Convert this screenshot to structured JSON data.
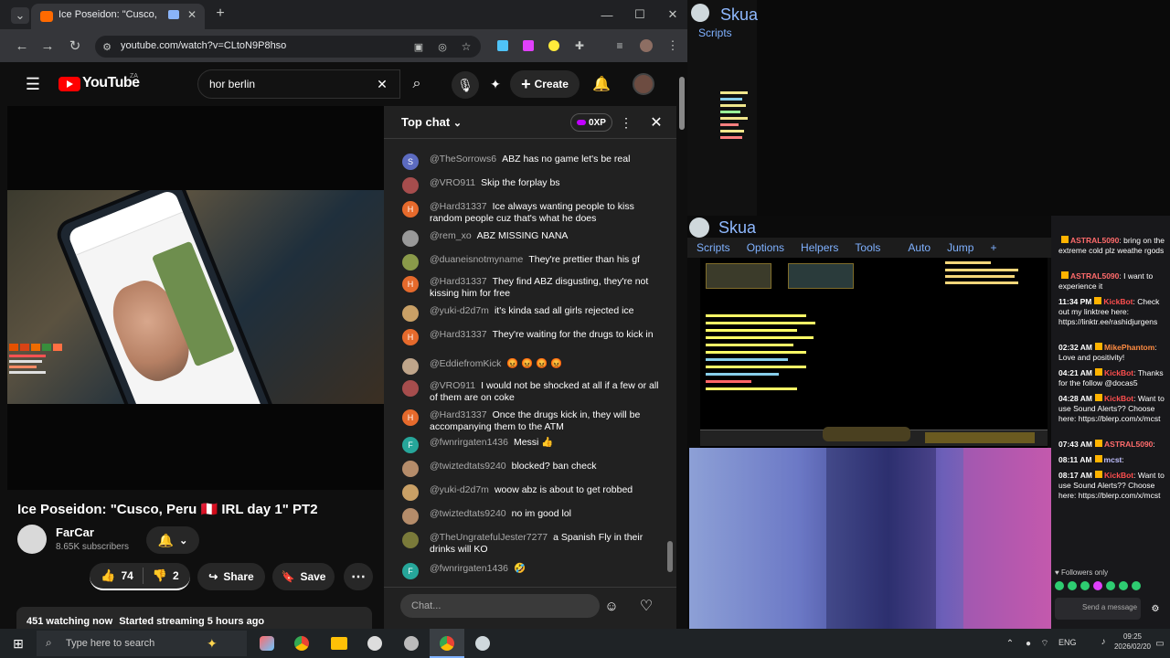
{
  "browser": {
    "tab_title": "Ice Poseidon: \"Cusco, Peru",
    "url": "youtube.com/watch?v=CLtoN9P8hso"
  },
  "youtube": {
    "logo": "YouTube",
    "region": "ZA",
    "search_value": "hor berlin",
    "create_label": "Create",
    "video_title": "Ice Poseidon: \"Cusco, Peru 🇵🇪 IRL day 1\" PT2",
    "channel_name": "FarCar",
    "subscribers": "8.65K subscribers",
    "likes": "74",
    "dislikes": "2",
    "share_label": "Share",
    "save_label": "Save",
    "watching": "451 watching now",
    "started": "Started streaming 5 hours ago"
  },
  "chat": {
    "header": "Top chat",
    "xp_label": "0XP",
    "placeholder": "Chat...",
    "messages": [
      {
        "author": "@TheSorrows6",
        "text": "ABZ has no game let's be real",
        "color": "#5c6bc0",
        "initial": "S"
      },
      {
        "author": "@VRO911",
        "text": "Skip the forplay bs",
        "color": "#a64d4d",
        "initial": ""
      },
      {
        "author": "@Hard31337",
        "text": "Ice always wanting people to kiss random people cuz that's what he does",
        "color": "#e66a2c",
        "initial": "H"
      },
      {
        "author": "@rem_xo",
        "text": "ABZ MISSING NANA",
        "color": "#999",
        "initial": ""
      },
      {
        "author": "@duaneisnotmyname",
        "text": "They're prettier than his gf",
        "color": "#8a9a4a",
        "initial": ""
      },
      {
        "author": "@Hard31337",
        "text": "They find ABZ disgusting, they're not kissing him for free",
        "color": "#e66a2c",
        "initial": "H"
      },
      {
        "author": "@yuki-d2d7m",
        "text": "it's kinda sad all girls rejected ice",
        "color": "#c9a066",
        "initial": ""
      },
      {
        "author": "@Hard31337",
        "text": "They're waiting for the drugs to kick in",
        "color": "#e66a2c",
        "initial": "H"
      },
      {
        "author": "@EddiefromKick",
        "text": "😡 😡 😡 😡",
        "color": "#bfa58a",
        "initial": ""
      },
      {
        "author": "@VRO911",
        "text": "I would not be shocked at all if a few or all of them are on coke",
        "color": "#a64d4d",
        "initial": ""
      },
      {
        "author": "@Hard31337",
        "text": "Once the drugs kick in, they will be accompanying them to the ATM",
        "color": "#e66a2c",
        "initial": "H"
      },
      {
        "author": "@fwnrirgaten1436",
        "text": "Messi 👍",
        "color": "#26a69a",
        "initial": "F"
      },
      {
        "author": "@twiztedtats9240",
        "text": "blocked? ban check",
        "color": "#b58c6a",
        "initial": ""
      },
      {
        "author": "@yuki-d2d7m",
        "text": "woow abz is about to get robbed",
        "color": "#c9a066",
        "initial": ""
      },
      {
        "author": "@twiztedtats9240",
        "text": "no im good lol",
        "color": "#b58c6a",
        "initial": ""
      },
      {
        "author": "@TheUngratefulJester7277",
        "text": "a Spanish Fly in their drinks will KO",
        "color": "#7a7a3a",
        "initial": ""
      },
      {
        "author": "@fwnrirgaten1436",
        "text": "🤣",
        "color": "#26a69a",
        "initial": "F"
      }
    ]
  },
  "skua": {
    "title": "Skua",
    "scripts": "Scripts",
    "menu": [
      "Scripts",
      "Options",
      "Helpers",
      "Tools",
      "Auto",
      "Jump",
      "+"
    ]
  },
  "twitch": {
    "messages": [
      {
        "time": "",
        "user": "ASTRAL5090",
        "text": ": bring on the extreme cold plz weathe rgods",
        "color": "#ff6b6b"
      },
      {
        "time": "",
        "user": "ASTRAL5090",
        "text": ": I want to experience it",
        "color": "#ff6b6b"
      },
      {
        "time": "11:34 PM",
        "user": "KickBot",
        "text": ": Check out my linktree here: https://linktr.ee/rashidjurgens",
        "color": "#ff4f4f"
      },
      {
        "time": "02:32 AM",
        "user": "MikePhantom",
        "text": ": Love and positivity!",
        "color": "#ff8c42"
      },
      {
        "time": "04:21 AM",
        "user": "KickBot",
        "text": ": Thanks for the follow @docas5",
        "color": "#ff4f4f"
      },
      {
        "time": "04:28 AM",
        "user": "KickBot",
        "text": ": Want to use Sound Alerts?? Choose here: https://blerp.com/x/mcst",
        "color": "#ff4f4f"
      },
      {
        "time": "07:43 AM",
        "user": "ASTRAL5090",
        "text": ":",
        "color": "#ff6b6b"
      },
      {
        "time": "08:11 AM",
        "user": "mcst",
        "text": ":",
        "color": "#c0c0ff"
      },
      {
        "time": "08:17 AM",
        "user": "KickBot",
        "text": ": Want to use Sound Alerts?? Choose here: https://blerp.com/x/mcst",
        "color": "#ff4f4f"
      }
    ],
    "followers_only": "Followers only",
    "send_message": "Send a message"
  },
  "taskbar": {
    "search_placeholder": "Type here to search",
    "lang": "ENG",
    "time": "09:25",
    "date": "2026/02/20"
  },
  "colors": {
    "youtube_red": "#ff0000",
    "chat_bg": "#212121",
    "like_underline": "#ffffff"
  }
}
